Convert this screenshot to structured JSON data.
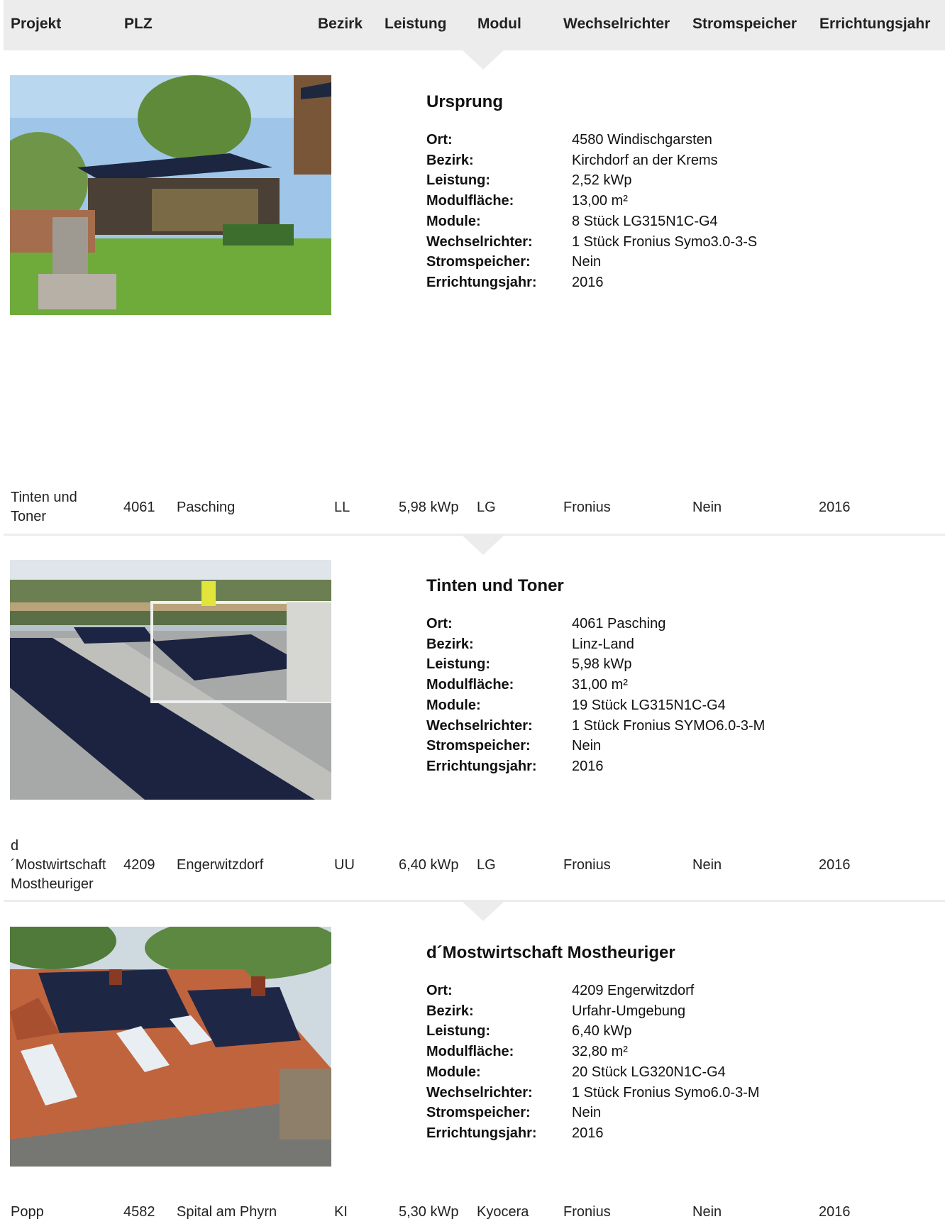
{
  "table": {
    "columns": [
      "Projekt",
      "PLZ",
      "Bezirk",
      "Leistung",
      "Modul",
      "Wechselrichter",
      "Stromspeicher",
      "Errichtungsjahr"
    ],
    "detail_labels": [
      "Ort:",
      "Bezirk:",
      "Leistung:",
      "Modulfläche:",
      "Module:",
      "Wechselrichter:",
      "Stromspeicher:",
      "Errichtungsjahr:"
    ],
    "rows": [
      {
        "projekt_lines": [
          "Tinten und",
          "Toner"
        ],
        "plz": "4061",
        "ort": "Pasching",
        "bezirk": "LL",
        "leistung": "5,98 kWp",
        "modul": "LG",
        "wechselrichter": "Fronius",
        "stromspeicher": "Nein",
        "jahr": "2016"
      },
      {
        "projekt_lines": [
          "d",
          "´Mostwirtschaft",
          "Mostheuriger"
        ],
        "plz": "4209",
        "ort": "Engerwitzdorf",
        "bezirk": "UU",
        "leistung": "6,40 kWp",
        "modul": "LG",
        "wechselrichter": "Fronius",
        "stromspeicher": "Nein",
        "jahr": "2016"
      },
      {
        "projekt_lines": [
          "Popp"
        ],
        "plz": "4582",
        "ort": "Spital am Phyrn",
        "bezirk": "KI",
        "leistung": "5,30 kWp",
        "modul": "Kyocera",
        "wechselrichter": "Fronius",
        "stromspeicher": "Nein",
        "jahr": "2016"
      }
    ]
  },
  "details": [
    {
      "title": "Ursprung",
      "values": [
        "4580 Windischgarsten",
        "Kirchdorf an der Krems",
        "2,52 kWp",
        "13,00 m²",
        "8 Stück LG315N1C-G4",
        "1 Stück Fronius Symo3.0-3-S",
        "Nein",
        "2016"
      ]
    },
    {
      "title": "Tinten und Toner",
      "values": [
        "4061 Pasching",
        "Linz-Land",
        "5,98 kWp",
        "31,00 m²",
        "19 Stück LG315N1C-G4",
        "1 Stück Fronius SYMO6.0-3-M",
        "Nein",
        "2016"
      ]
    },
    {
      "title": "d´Mostwirtschaft Mostheuriger",
      "values": [
        "4209 Engerwitzdorf",
        "Urfahr-Umgebung",
        "6,40 kWp",
        "32,80 m²",
        "20 Stück LG320N1C-G4",
        "1 Stück Fronius Symo6.0-3-M",
        "Nein",
        "2016"
      ]
    }
  ],
  "colors": {
    "header_bg": "#ececec",
    "text": "#222222"
  }
}
